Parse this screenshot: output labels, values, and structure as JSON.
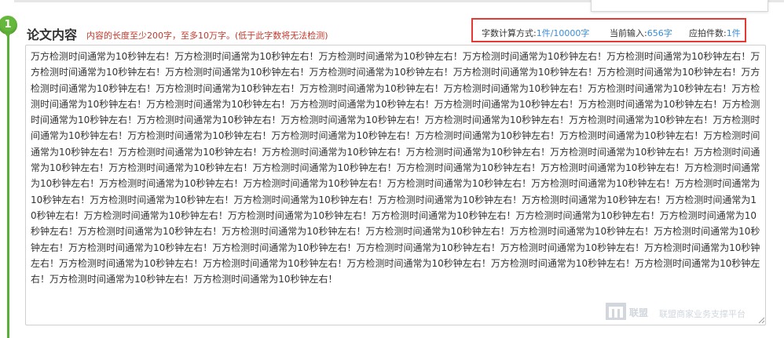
{
  "section": {
    "step_number": "1",
    "title": "论文内容",
    "hint": "内容的长度至少200字，至多10万字。(低于此字数将无法检测)"
  },
  "stats": {
    "method_label": "字数计算方式:",
    "method_value": "1件/10000字",
    "current_label": "当前输入:",
    "current_value": "656字",
    "pieces_label": "应拍件数:",
    "pieces_value": "1件"
  },
  "editor": {
    "content": "万方检测时间通常为10秒钟左右！万方检测时间通常为10秒钟左右！万方检测时间通常为10秒钟左右！万方检测时间通常为10秒钟左右！万方检测时间通常为10秒钟左右！万方检测时间通常为10秒钟左右！万方检测时间通常为10秒钟左右！万方检测时间通常为10秒钟左右！万方检测时间通常为10秒钟左右！万方检测时间通常为10秒钟左右！万方检测时间通常为10秒钟左右！万方检测时间通常为10秒钟左右！万方检测时间通常为10秒钟左右！万方检测时间通常为10秒钟左右！万方检测时间通常为10秒钟左右！万方检测时间通常为10秒钟左右！万方检测时间通常为10秒钟左右！万方检测时间通常为10秒钟左右！万方检测时间通常为10秒钟左右！万方检测时间通常为10秒钟左右！万方检测时间通常为10秒钟左右！万方检测时间通常为10秒钟左右！万方检测时间通常为10秒钟左右！万方检测时间通常为10秒钟左右！万方检测时间通常为10秒钟左右！万方检测时间通常为10秒钟左右！万方检测时间通常为10秒钟左右！万方检测时间通常为10秒钟左右！万方检测时间通常为10秒钟左右！万方检测时间通常为10秒钟左右！万方检测时间通常为10秒钟左右！万方检测时间通常为10秒钟左右！万方检测时间通常为10秒钟左右！万方检测时间通常为10秒钟左右！万方检测时间通常为10秒钟左右！万方检测时间通常为10秒钟左右！万方检测时间通常为10秒钟左右！万方检测时间通常为10秒钟左右！万方检测时间通常为10秒钟左右！万方检测时间通常为10秒钟左右！万方检测时间通常为10秒钟左右！万方检测时间通常为10秒钟左右！万方检测时间通常为10秒钟左右！万方检测时间通常为10秒钟左右！万方检测时间通常为10秒钟左右！万方检测时间通常为10秒钟左右！万方检测时间通常为10秒钟左右！万方检测时间通常为10秒钟左右！万方检测时间通常为10秒钟左右！万方检测时间通常为10秒钟左右！万方检测时间通常为10秒钟左右！万方检测时间通常为10秒钟左右！万方检测时间通常为10秒钟左右！万方检测时间通常为10秒钟左右！万方检测时间通常为10秒钟左右！万方检测时间通常为10秒钟左右！万方检测时间通常为10秒钟左右！万方检测时间通常为10秒钟左右！万方检测时间通常为10秒钟左右！万方检测时间通常为10秒钟左右！万方检测时间通常为10秒钟左右！万方检测时间通常为10秒钟左右！万方检测时间通常为10秒钟左右！万方检测时间通常为10秒钟左右！万方检测时间通常为10秒钟左右！万方检测时间通常为10秒钟左右！万方检测时间通常为10秒钟左右！万方检测时间通常为10秒钟左右！万方检测时间通常为10秒钟左右！万方检测时间通常为10秒钟左右！万方检测时间通常为10秒钟左右！万方检测时间通常为10秒钟左右！万方检测时间通常为10秒钟左右！"
  },
  "watermark": {
    "brand": "联盟",
    "tagline": "联盟商家业务支撑平台"
  },
  "colors": {
    "accent_green": "#65b83c",
    "hint_red": "#c0392b",
    "value_blue": "#3a8bd6",
    "highlight_border": "#e53935"
  }
}
